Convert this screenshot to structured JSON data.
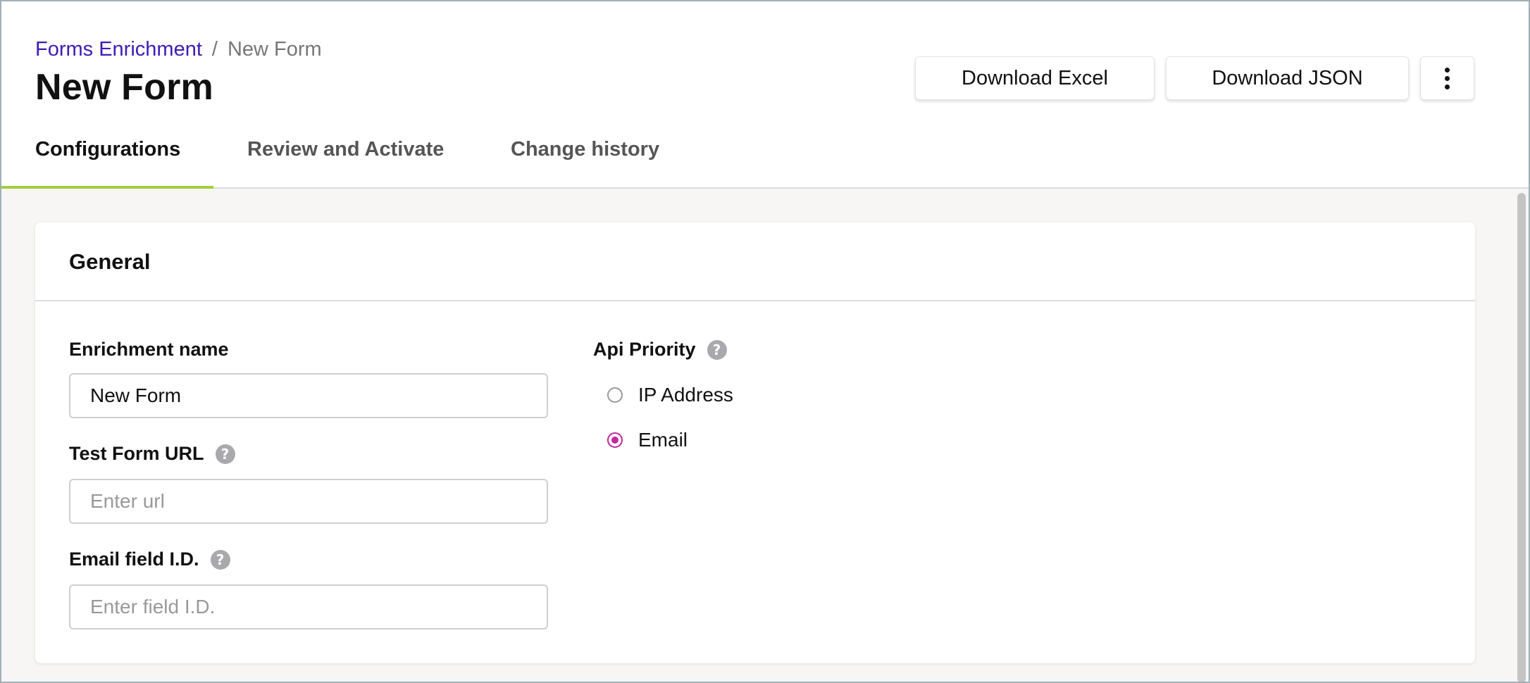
{
  "breadcrumb": {
    "parent": "Forms Enrichment",
    "separator": "/",
    "current": "New Form"
  },
  "page": {
    "title": "New Form"
  },
  "toolbar": {
    "download_excel": "Download Excel",
    "download_json": "Download JSON",
    "more_icon": "vertical-ellipsis-icon"
  },
  "tabs": [
    {
      "label": "Configurations",
      "active": true
    },
    {
      "label": "Review and Activate",
      "active": false
    },
    {
      "label": "Change history",
      "active": false
    }
  ],
  "general": {
    "title": "General",
    "enrichment_name": {
      "label": "Enrichment name",
      "value": "New Form"
    },
    "test_form_url": {
      "label": "Test Form URL",
      "placeholder": "Enter url",
      "value": ""
    },
    "email_field_id": {
      "label": "Email field I.D.",
      "placeholder": "Enter field I.D.",
      "value": ""
    },
    "api_priority": {
      "label": "Api Priority",
      "options": [
        {
          "label": "IP Address",
          "selected": false
        },
        {
          "label": "Email",
          "selected": true
        }
      ]
    }
  },
  "help_glyph": "?",
  "colors": {
    "link": "#3f1cb5",
    "active_tab_underline": "#a3cf3a",
    "radio_selected": "#c0299e",
    "help_icon": "#a9a9ad"
  }
}
